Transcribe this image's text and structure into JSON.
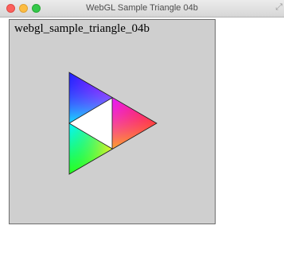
{
  "window": {
    "title": "WebGL Sample Triangle 04b",
    "fullscreen_glyph": "⤢"
  },
  "canvas": {
    "label": "webgl_sample_triangle_04b"
  },
  "icons": [
    "close-icon",
    "minimize-icon",
    "zoom-icon",
    "fullscreen-icon"
  ]
}
